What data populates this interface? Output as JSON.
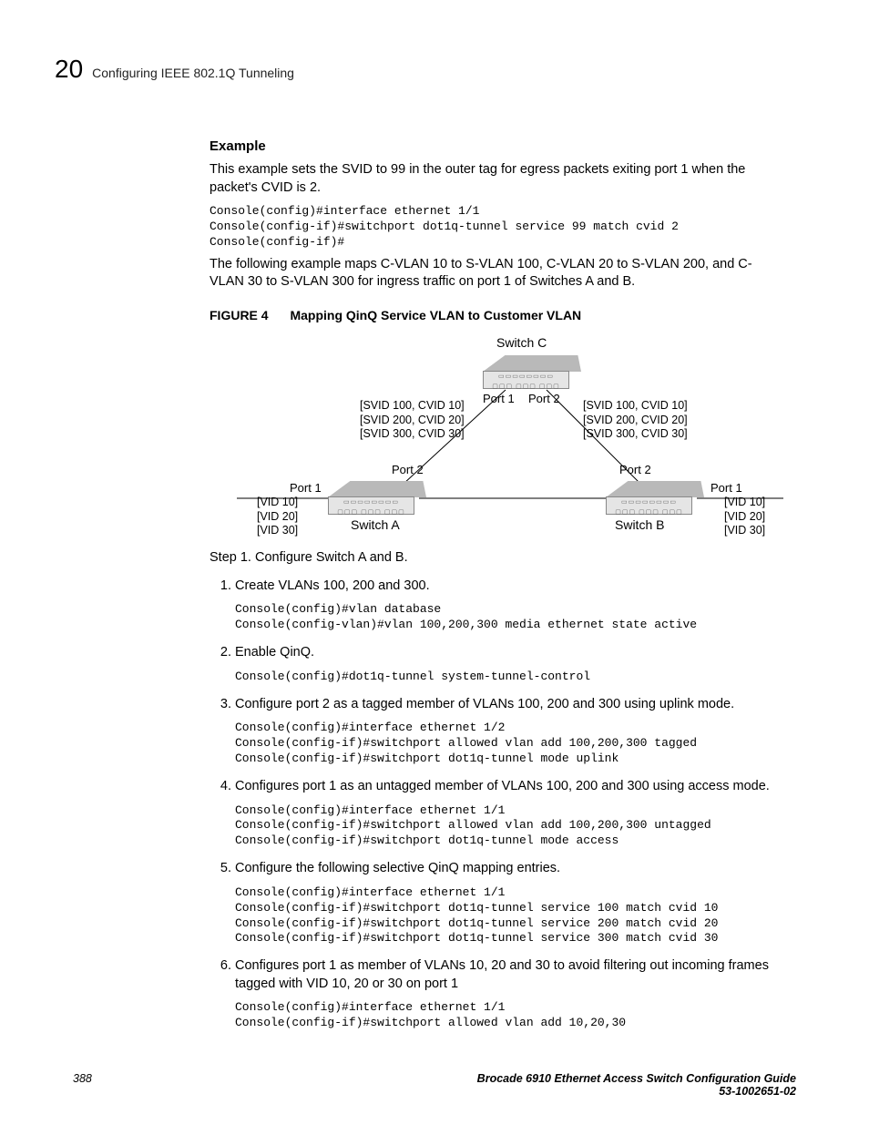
{
  "header": {
    "chapter_number": "20",
    "chapter_title": "Configuring IEEE 802.1Q Tunneling"
  },
  "example": {
    "heading": "Example",
    "intro": "This example sets the SVID to 99 in the outer tag for egress packets exiting port 1 when the packet's CVID is 2.",
    "code": "Console(config)#interface ethernet 1/1\nConsole(config-if)#switchport dot1q-tunnel service 99 match cvid 2\nConsole(config-if)#",
    "followup": "The following example maps C-VLAN 10 to S-VLAN 100, C-VLAN 20 to S-VLAN 200, and C-VLAN 30 to S-VLAN 300 for ingress traffic on port 1 of Switches A and B."
  },
  "figure": {
    "label": "FIGURE 4",
    "caption": "Mapping QinQ Service VLAN to Customer VLAN",
    "labels": {
      "switch_c": "Switch C",
      "switch_a": "Switch A",
      "switch_b": "Switch B",
      "port1_c": "Port 1",
      "port2_c": "Port 2",
      "port2_a": "Port 2",
      "port1_a": "Port 1",
      "port2_b": "Port 2",
      "port1_b": "Port 1",
      "left_s_tags_1": "[SVID 100, CVID 10]",
      "left_s_tags_2": "[SVID 200, CVID 20]",
      "left_s_tags_3": "[SVID 300, CVID 30]",
      "right_s_tags_1": "[SVID 100, CVID 10]",
      "right_s_tags_2": "[SVID 200, CVID 20]",
      "right_s_tags_3": "[SVID 300, CVID 30]",
      "left_v_tags_1": "[VID 10]",
      "left_v_tags_2": "[VID 20]",
      "left_v_tags_3": "[VID 30]",
      "right_v_tags_1": "[VID 10]",
      "right_v_tags_2": "[VID 20]",
      "right_v_tags_3": "[VID 30]"
    }
  },
  "step_intro": "Step 1. Configure Switch A and B.",
  "steps": [
    {
      "n": "1",
      "text": "Create VLANs 100, 200 and 300.",
      "code": "Console(config)#vlan database\nConsole(config-vlan)#vlan 100,200,300 media ethernet state active"
    },
    {
      "n": "2",
      "text": "Enable QinQ.",
      "code": "Console(config)#dot1q-tunnel system-tunnel-control"
    },
    {
      "n": "3",
      "text": "Configure port 2 as a tagged member of VLANs 100, 200 and 300 using uplink mode.",
      "code": "Console(config)#interface ethernet 1/2\nConsole(config-if)#switchport allowed vlan add 100,200,300 tagged\nConsole(config-if)#switchport dot1q-tunnel mode uplink"
    },
    {
      "n": "4",
      "text": "Configures port 1 as an untagged member of VLANs 100, 200 and 300 using access mode.",
      "code": "Console(config)#interface ethernet 1/1\nConsole(config-if)#switchport allowed vlan add 100,200,300 untagged\nConsole(config-if)#switchport dot1q-tunnel mode access"
    },
    {
      "n": "5",
      "text": "Configure the following selective QinQ mapping entries.",
      "code": "Console(config)#interface ethernet 1/1\nConsole(config-if)#switchport dot1q-tunnel service 100 match cvid 10\nConsole(config-if)#switchport dot1q-tunnel service 200 match cvid 20\nConsole(config-if)#switchport dot1q-tunnel service 300 match cvid 30"
    },
    {
      "n": "6",
      "text": "Configures port 1 as member of VLANs 10, 20 and 30 to avoid filtering out incoming frames tagged with VID 10, 20 or 30 on port 1",
      "code": "Console(config)#interface ethernet 1/1\nConsole(config-if)#switchport allowed vlan add 10,20,30"
    }
  ],
  "footer": {
    "page_number": "388",
    "book_title": "Brocade 6910 Ethernet Access Switch Configuration Guide",
    "doc_id": "53-1002651-02"
  }
}
